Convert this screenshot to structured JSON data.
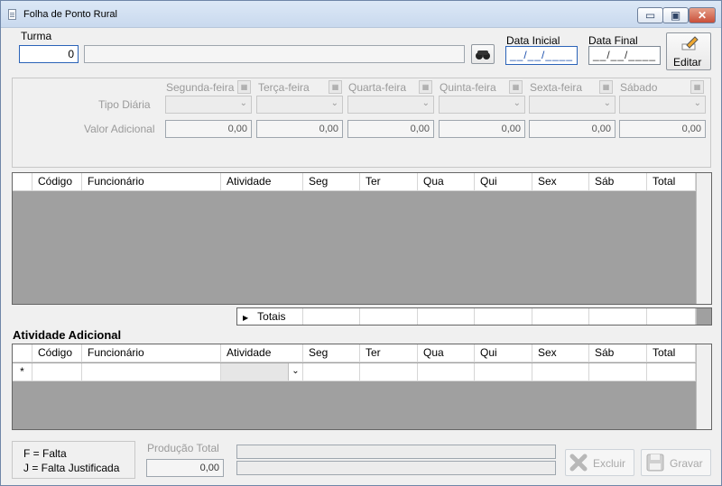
{
  "window": {
    "title": "Folha de Ponto Rural",
    "min_glyph": "▭",
    "max_glyph": "▣",
    "close_glyph": "✕"
  },
  "top": {
    "turma_label": "Turma",
    "turma_code": "0",
    "turma_name": "",
    "data_inicial_label": "Data Inicial",
    "data_inicial_value": "__/__/____",
    "data_final_label": "Data Final",
    "data_final_value": "__/__/____",
    "editar_label": "Editar"
  },
  "days": {
    "names": [
      "Segunda-feira",
      "Terça-feira",
      "Quarta-feira",
      "Quinta-feira",
      "Sexta-feira",
      "Sábado"
    ],
    "tipo_diaria_label": "Tipo Diária",
    "valor_adicional_label": "Valor Adicional",
    "valores": [
      "0,00",
      "0,00",
      "0,00",
      "0,00",
      "0,00",
      "0,00"
    ]
  },
  "main_grid": {
    "columns": [
      "",
      "Código",
      "Funcionário",
      "Atividade",
      "Seg",
      "Ter",
      "Qua",
      "Qui",
      "Sex",
      "Sáb",
      "Total"
    ],
    "totals_label": "Totais",
    "totals_marker": "▶"
  },
  "adicional": {
    "title": "Atividade Adicional",
    "columns": [
      "",
      "Código",
      "Funcionário",
      "Atividade",
      "Seg",
      "Ter",
      "Qua",
      "Qui",
      "Sex",
      "Sáb",
      "Total"
    ],
    "new_row_marker": "*"
  },
  "footer": {
    "legend_falta": "F = Falta",
    "legend_justificada": "J = Falta Justificada",
    "producao_label": "Produção Total",
    "producao_value": "0,00",
    "excluir_label": "Excluir",
    "gravar_label": "Gravar"
  },
  "icons": {
    "binoculars": "binoculars-icon",
    "edit": "edit-pen-icon",
    "delete": "delete-x-icon",
    "save": "floppy-disk-icon"
  }
}
